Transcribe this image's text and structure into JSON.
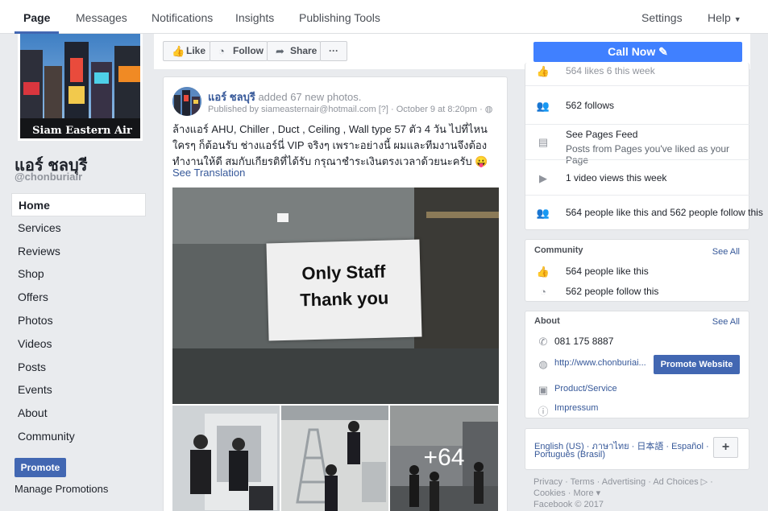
{
  "tabs": {
    "page": "Page",
    "messages": "Messages",
    "notifications": "Notifications",
    "insights": "Insights",
    "publishing_tools": "Publishing Tools",
    "settings": "Settings",
    "help": "Help"
  },
  "profile": {
    "cover_caption": "Siam Eastern Air",
    "name": "แอร์ ชลบุรี",
    "handle": "@chonburiair"
  },
  "nav": [
    "Home",
    "Services",
    "Reviews",
    "Shop",
    "Offers",
    "Photos",
    "Videos",
    "Posts",
    "Events",
    "About",
    "Community"
  ],
  "promote": {
    "button": "Promote",
    "manage": "Manage Promotions"
  },
  "actions": {
    "like": "Like",
    "follow": "Follow",
    "share": "Share",
    "more": "···",
    "call_now": "Call Now"
  },
  "post": {
    "author": "แอร์ ชลบุรี",
    "action": "added 67 new photos.",
    "published_by": "Published by siameasternair@hotmail.com",
    "qmark": "[?]",
    "date": "October 9 at 8:20pm",
    "text": "ล้างแอร์ AHU, Chiller , Duct , Ceiling , Wall type 57 ตัว 4 วัน ไปที่ไหน ใครๆ ก็ต้อนรับ ช่างแอร์นี่ VIP จริงๆ เพราะอย่างนี้ ผมและทีมงานจึงต้องทำงานให้ดี สมกับเกียรติที่ได้รับ กรุณาชำระเงินตรงเวลาด้วยนะครับ 😛",
    "see_translation": "See Translation",
    "sign_line1": "Only  Staff",
    "sign_line2": "Thank  you",
    "more_photos": "+64"
  },
  "stats": {
    "likes_week": "564 likes  6 this week",
    "follows": "562 follows",
    "pages_feed_title": "See Pages Feed",
    "pages_feed_sub": "Posts from Pages you've liked as your Page",
    "video_views": "1 video views this week",
    "like_follow": "564 people like this and 562 people follow this"
  },
  "community": {
    "title": "Community",
    "see_all": "See All",
    "likes": "564 people like this",
    "follows": "562 people follow this"
  },
  "about": {
    "title": "About",
    "see_all": "See All",
    "phone": "081 175 8887",
    "website": "http://www.chonburiai...",
    "promote_website": "Promote Website",
    "category": "Product/Service",
    "impressum": "Impressum"
  },
  "languages": {
    "row1": "English (US) · ภาษาไทย · 日本語 · Español ·",
    "row2": "Português (Brasil)",
    "plus": "+"
  },
  "footer": {
    "line1": "Privacy · Terms · Advertising · Ad Choices ▷ ·",
    "line2": "Cookies · More ▾",
    "line3": "Facebook © 2017"
  },
  "colors": {
    "brand": "#4267b2",
    "call_now": "#4080ff",
    "link": "#365899"
  }
}
